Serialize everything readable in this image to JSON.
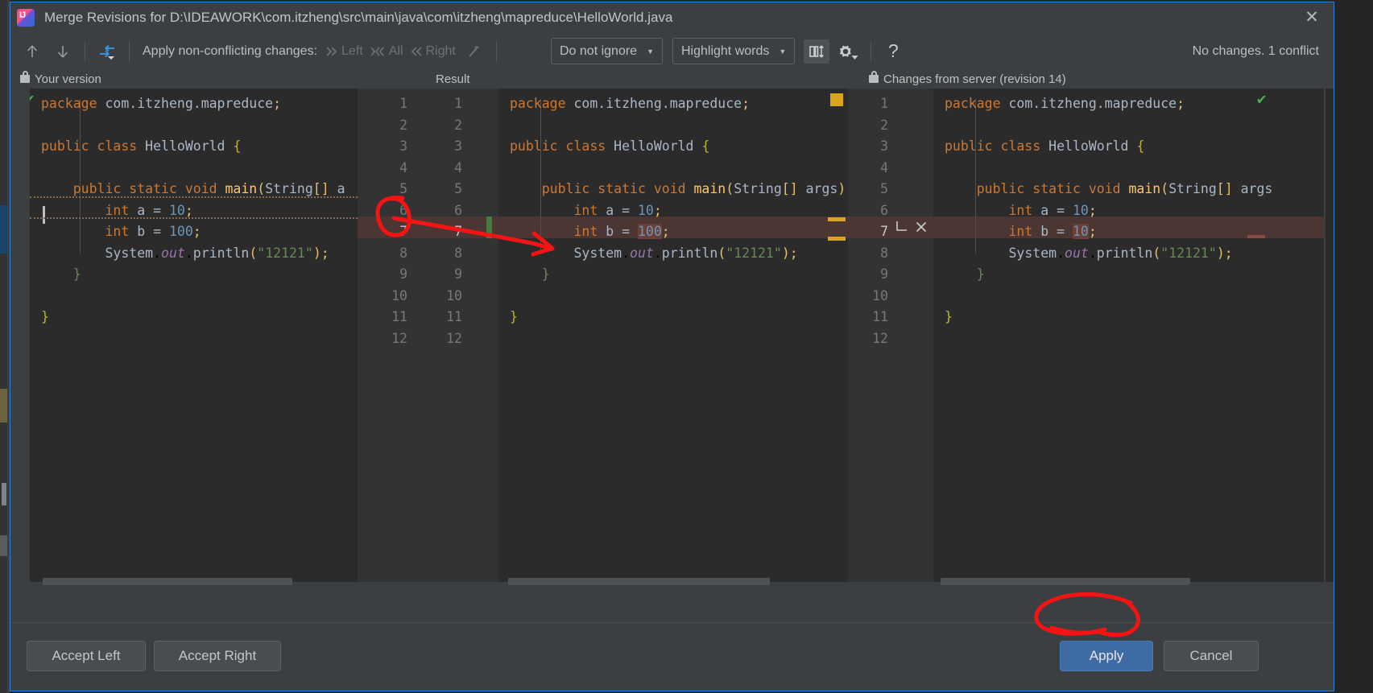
{
  "window": {
    "title": "Merge Revisions for D:\\IDEAWORK\\com.itzheng\\src\\main\\java\\com\\itzheng\\mapreduce\\HelloWorld.java",
    "app_icon": "intellij-idea-icon",
    "close_label": "✕"
  },
  "toolbar": {
    "prev_icon": "arrow-up-icon",
    "next_icon": "arrow-down-icon",
    "resolve_icon": "apply-all-non-conflicting-icon",
    "apply_label": "Apply non-conflicting changes:",
    "left_label": "Left",
    "all_label": "All",
    "right_label": "Right",
    "magic_icon": "magic-wand-icon",
    "ignore_policy": "Do not ignore",
    "highlight_policy": "Highlight words",
    "collapse_icon": "collapse-unchanged-fragments-icon",
    "settings_icon": "gear-icon",
    "help_icon": "help-icon",
    "status": "No changes. 1 conflict"
  },
  "panes": {
    "left": {
      "title": "Your version",
      "lock_icon": "lock-icon",
      "ok_icon": "check-icon"
    },
    "center": {
      "title": "Result"
    },
    "right": {
      "title": "Changes from server (revision 14)",
      "lock_icon": "lock-icon",
      "ok_icon": "check-icon"
    }
  },
  "code": {
    "left_lines": [
      {
        "n": 1,
        "html": "<span class='kw'>package</span> <span class='pl'>com.itzheng.mapreduce</span><span class='sbr'>;</span>"
      },
      {
        "n": 2,
        "html": ""
      },
      {
        "n": 3,
        "html": "<span class='kw'>public class</span> <span class='cls'>HelloWorld</span> <span class='brc'>{</span>"
      },
      {
        "n": 4,
        "html": ""
      },
      {
        "n": 5,
        "html": "    <span class='kw'>public static void</span> <span class='fn'>main</span><span class='sbr'>(</span><span class='cls'>String</span><span class='sbr'>[]</span> <span class='pl'>a</span>"
      },
      {
        "n": 6,
        "html": "        <span class='kw'>int</span> <span class='pl'>a</span> <span class='pl'>=</span> <span class='num'>10</span><span class='sbr'>;</span>"
      },
      {
        "n": 7,
        "html": "        <span class='kw'>int</span> <span class='pl'>b</span> <span class='pl'>=</span> <span class='num'>100</span><span class='sbr'>;</span>"
      },
      {
        "n": 8,
        "html": "        <span class='cls'>System</span>.<span class='fld'>out</span>.<span class='pl'>println</span><span class='sbr'>(</span><span class='str'>\"12121\"</span><span class='sbr'>);</span>"
      },
      {
        "n": 9,
        "html": "    <span class='brc2'>}</span>"
      },
      {
        "n": 10,
        "html": ""
      },
      {
        "n": 11,
        "html": "<span class='brc'>}</span>"
      },
      {
        "n": 12,
        "html": ""
      }
    ],
    "center_lines": [
      {
        "n": 1,
        "html": "<span class='kw'>package</span> <span class='pl'>com.itzheng.mapreduce</span><span class='sbr'>;</span>"
      },
      {
        "n": 2,
        "html": ""
      },
      {
        "n": 3,
        "html": "<span class='kw'>public class</span> <span class='cls'>HelloWorld</span> <span class='brc'>{</span>"
      },
      {
        "n": 4,
        "html": ""
      },
      {
        "n": 5,
        "html": "    <span class='kw'>public static void</span> <span class='fn'>main</span><span class='sbr'>(</span><span class='cls'>String</span><span class='sbr'>[]</span> <span class='pl'>args</span><span class='sbr'>)</span>"
      },
      {
        "n": 6,
        "html": "        <span class='kw'>int</span> <span class='pl'>a</span> <span class='pl'>=</span> <span class='num'>10</span><span class='sbr'>;</span>"
      },
      {
        "n": 7,
        "html": "        <span class='kw'>int</span> <span class='pl'>b</span> <span class='pl'>=</span> <span class='num inline-hl'>100</span><span class='sbr'>;</span>"
      },
      {
        "n": 8,
        "html": "        <span class='cls'>System</span>.<span class='fld'>out</span>.<span class='pl'>println</span><span class='sbr'>(</span><span class='str'>\"12121\"</span><span class='sbr'>);</span>"
      },
      {
        "n": 9,
        "html": "    <span class='brc2'>}</span>"
      },
      {
        "n": 10,
        "html": ""
      },
      {
        "n": 11,
        "html": "<span class='brc'>}</span>"
      },
      {
        "n": 12,
        "html": ""
      }
    ],
    "right_lines": [
      {
        "n": 1,
        "html": "<span class='kw'>package</span> <span class='pl'>com.itzheng.mapreduce</span><span class='sbr'>;</span>"
      },
      {
        "n": 2,
        "html": ""
      },
      {
        "n": 3,
        "html": "<span class='kw'>public class</span> <span class='cls'>HelloWorld</span> <span class='brc'>{</span>"
      },
      {
        "n": 4,
        "html": ""
      },
      {
        "n": 5,
        "html": "    <span class='kw'>public static void</span> <span class='fn'>main</span><span class='sbr'>(</span><span class='cls'>String</span><span class='sbr'>[]</span> <span class='pl'>args</span>"
      },
      {
        "n": 6,
        "html": "        <span class='kw'>int</span> <span class='pl'>a</span> <span class='pl'>=</span> <span class='num'>10</span><span class='sbr'>;</span>"
      },
      {
        "n": 7,
        "html": "        <span class='kw'>int</span> <span class='pl'>b</span> <span class='pl'>=</span> <span class='num inline-hl'>10</span><span class='sbr'>;</span>"
      },
      {
        "n": 8,
        "html": "        <span class='cls'>System</span>.<span class='fld'>out</span>.<span class='pl'>println</span><span class='sbr'>(</span><span class='str'>\"12121\"</span><span class='sbr'>);</span>"
      },
      {
        "n": 9,
        "html": "    <span class='brc2'>}</span>"
      },
      {
        "n": 10,
        "html": ""
      },
      {
        "n": 11,
        "html": "<span class='brc'>}</span>"
      },
      {
        "n": 12,
        "html": ""
      }
    ],
    "line_numbers": [
      1,
      2,
      3,
      4,
      5,
      6,
      7,
      8,
      9,
      10,
      11,
      12
    ],
    "conflict_line": 7
  },
  "gutter_actions": {
    "accept_icon": "accept-change-icon",
    "ignore_icon": "ignore-change-icon",
    "conflict_line_label": "7"
  },
  "footer": {
    "accept_left": "Accept Left",
    "accept_right": "Accept Right",
    "apply": "Apply",
    "cancel": "Cancel"
  },
  "colors": {
    "accent": "#3f6ba5",
    "conflict": "#4b3634",
    "conflict_inline": "#6b3f35",
    "marker_yellow": "#d9a521",
    "marker_green": "#4caf50",
    "annotation_red": "#f41414",
    "editor_bg": "#2b2b2b",
    "gutter_bg": "#313335",
    "dialog_bg": "#3c3f41"
  }
}
